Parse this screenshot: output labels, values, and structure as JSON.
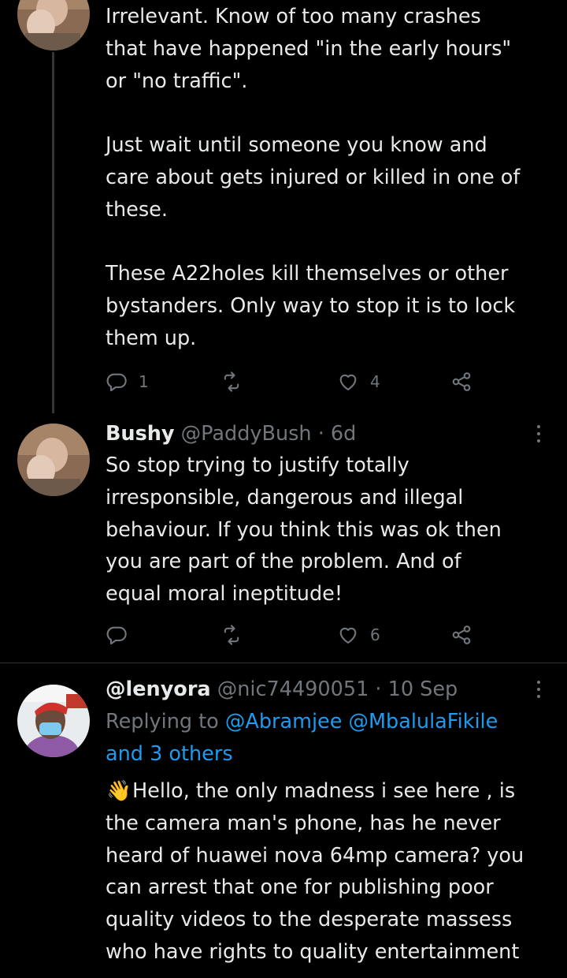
{
  "tweets": [
    {
      "avatar": "avatar-photo",
      "body": "Irrelevant. Know of too many crashes\nthat have happened \"in the early hours\"\nor \"no traffic\".\n\nJust wait until someone you know and\ncare about gets injured or killed in one of\nthese.\n\nThese A22holes kill themselves or other\nbystanders. Only way to stop it is to lock\nthem up.",
      "reply_count": "1",
      "retweet_count": "",
      "like_count": "4"
    },
    {
      "name": "Bushy",
      "handle": "@PaddyBush",
      "dot": "·",
      "time": "6d",
      "body": "So stop trying to justify totally\nirresponsible, dangerous and illegal\nbehaviour. If you think this was ok then\nyou are part of the problem. And of\nequal moral ineptitude!",
      "reply_count": "",
      "retweet_count": "",
      "like_count": "6"
    },
    {
      "name": "@lenyora",
      "handle": "@nic74490051",
      "dot": "·",
      "time": "10 Sep",
      "replying_prefix": "Replying to",
      "replying_mentions": "@Abramjee @MbalulaFikile",
      "replying_others": "and 3 others",
      "emoji": "👋",
      "body": "Hello, the only madness i see here , is\nthe camera man's phone, has he never\nheard of huawei nova 64mp camera? you\ncan arrest that one for publishing poor\nquality videos to the desperate massess\nwho have rights to quality entertainment"
    }
  ],
  "colors": {
    "background": "#000000",
    "text": "#e7e9ea",
    "muted": "#71767b",
    "link": "#1d9bf0",
    "divider": "#2f3336"
  },
  "icons": [
    "reply-icon",
    "retweet-icon",
    "like-icon",
    "share-icon",
    "more-icon"
  ]
}
